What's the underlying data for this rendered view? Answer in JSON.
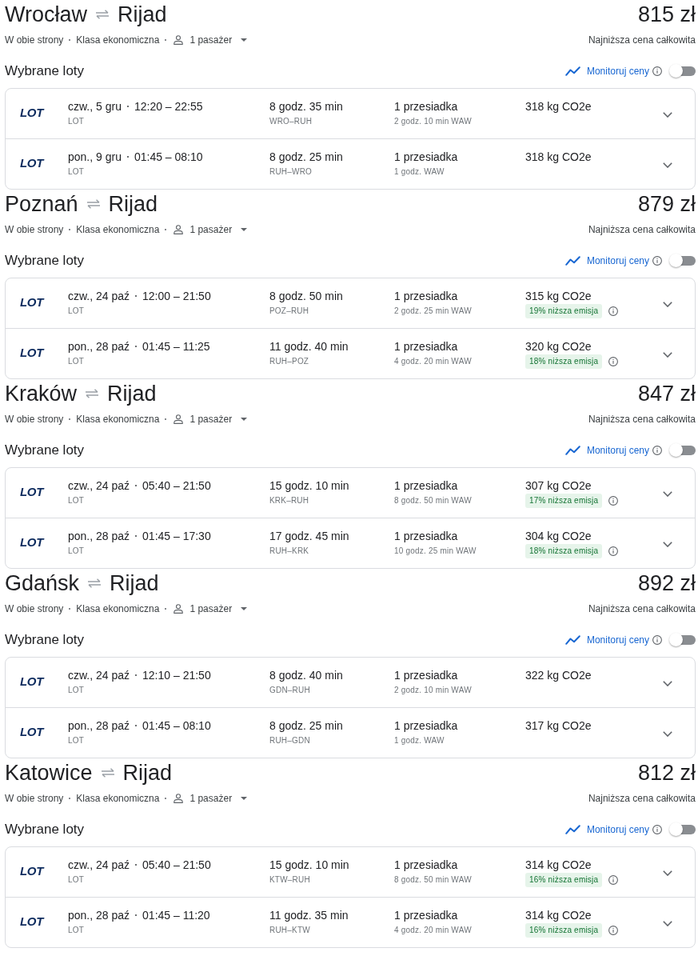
{
  "searches": [
    {
      "origin": "Wrocław",
      "destination": "Rijad",
      "price": "815 zł",
      "trip_type": "W obie strony",
      "cabin_class": "Klasa ekonomiczna",
      "passengers": "1 pasażer",
      "price_note": "Najniższa cena całkowita",
      "selected_heading": "Wybrane loty",
      "track_prices": {
        "label": "Monitoruj ceny",
        "on": false
      },
      "flights": [
        {
          "logo": "LOT",
          "date": "czw., 5 gru",
          "times": "12:20 – 22:55",
          "airline": "LOT",
          "duration": "8 godz. 35 min",
          "route": "WRO–RUH",
          "stops": "1 przesiadka",
          "layover": "2 godz. 10 min WAW",
          "emissions": "318 kg CO2e"
        },
        {
          "logo": "LOT",
          "date": "pon., 9 gru",
          "times": "01:45 – 08:10",
          "airline": "LOT",
          "duration": "8 godz. 25 min",
          "route": "RUH–WRO",
          "stops": "1 przesiadka",
          "layover": "1 godz. WAW",
          "emissions": "318 kg CO2e"
        }
      ]
    },
    {
      "origin": "Poznań",
      "destination": "Rijad",
      "price": "879 zł",
      "trip_type": "W obie strony",
      "cabin_class": "Klasa ekonomiczna",
      "passengers": "1 pasażer",
      "price_note": "Najniższa cena całkowita",
      "selected_heading": "Wybrane loty",
      "track_prices": {
        "label": "Monitoruj ceny",
        "on": false
      },
      "flights": [
        {
          "logo": "LOT",
          "date": "czw., 24 paź",
          "times": "12:00 – 21:50",
          "airline": "LOT",
          "duration": "8 godz. 50 min",
          "route": "POZ–RUH",
          "stops": "1 przesiadka",
          "layover": "2 godz. 25 min WAW",
          "emissions": "315 kg CO2e",
          "emissions_note": "19% niższa emisja"
        },
        {
          "logo": "LOT",
          "date": "pon., 28 paź",
          "times": "01:45 – 11:25",
          "airline": "LOT",
          "duration": "11 godz. 40 min",
          "route": "RUH–POZ",
          "stops": "1 przesiadka",
          "layover": "4 godz. 20 min WAW",
          "emissions": "320 kg CO2e",
          "emissions_note": "18% niższa emisja"
        }
      ]
    },
    {
      "origin": "Kraków",
      "destination": "Rijad",
      "price": "847 zł",
      "trip_type": "W obie strony",
      "cabin_class": "Klasa ekonomiczna",
      "passengers": "1 pasażer",
      "price_note": "Najniższa cena całkowita",
      "selected_heading": "Wybrane loty",
      "track_prices": {
        "label": "Monitoruj ceny",
        "on": false
      },
      "flights": [
        {
          "logo": "LOT",
          "date": "czw., 24 paź",
          "times": "05:40 – 21:50",
          "airline": "LOT",
          "duration": "15 godz. 10 min",
          "route": "KRK–RUH",
          "stops": "1 przesiadka",
          "layover": "8 godz. 50 min WAW",
          "emissions": "307 kg CO2e",
          "emissions_note": "17% niższa emisja"
        },
        {
          "logo": "LOT",
          "date": "pon., 28 paź",
          "times": "01:45 – 17:30",
          "airline": "LOT",
          "duration": "17 godz. 45 min",
          "route": "RUH–KRK",
          "stops": "1 przesiadka",
          "layover": "10 godz. 25 min WAW",
          "emissions": "304 kg CO2e",
          "emissions_note": "18% niższa emisja"
        }
      ]
    },
    {
      "origin": "Gdańsk",
      "destination": "Rijad",
      "price": "892 zł",
      "trip_type": "W obie strony",
      "cabin_class": "Klasa ekonomiczna",
      "passengers": "1 pasażer",
      "price_note": "Najniższa cena całkowita",
      "selected_heading": "Wybrane loty",
      "track_prices": {
        "label": "Monitoruj ceny",
        "on": false
      },
      "flights": [
        {
          "logo": "LOT",
          "date": "czw., 24 paź",
          "times": "12:10 – 21:50",
          "airline": "LOT",
          "duration": "8 godz. 40 min",
          "route": "GDN–RUH",
          "stops": "1 przesiadka",
          "layover": "2 godz. 10 min WAW",
          "emissions": "322 kg CO2e"
        },
        {
          "logo": "LOT",
          "date": "pon., 28 paź",
          "times": "01:45 – 08:10",
          "airline": "LOT",
          "duration": "8 godz. 25 min",
          "route": "RUH–GDN",
          "stops": "1 przesiadka",
          "layover": "1 godz. WAW",
          "emissions": "317 kg CO2e"
        }
      ]
    },
    {
      "origin": "Katowice",
      "destination": "Rijad",
      "price": "812 zł",
      "trip_type": "W obie strony",
      "cabin_class": "Klasa ekonomiczna",
      "passengers": "1 pasażer",
      "price_note": "Najniższa cena całkowita",
      "selected_heading": "Wybrane loty",
      "track_prices": {
        "label": "Monitoruj ceny",
        "on": false
      },
      "flights": [
        {
          "logo": "LOT",
          "date": "czw., 24 paź",
          "times": "05:40 – 21:50",
          "airline": "LOT",
          "duration": "15 godz. 10 min",
          "route": "KTW–RUH",
          "stops": "1 przesiadka",
          "layover": "8 godz. 50 min WAW",
          "emissions": "314 kg CO2e",
          "emissions_note": "16% niższa emisja"
        },
        {
          "logo": "LOT",
          "date": "pon., 28 paź",
          "times": "01:45 – 11:20",
          "airline": "LOT",
          "duration": "11 godz. 35 min",
          "route": "RUH–KTW",
          "stops": "1 przesiadka",
          "layover": "4 godz. 20 min WAW",
          "emissions": "314 kg CO2e",
          "emissions_note": "16% niższa emisja"
        }
      ]
    }
  ]
}
